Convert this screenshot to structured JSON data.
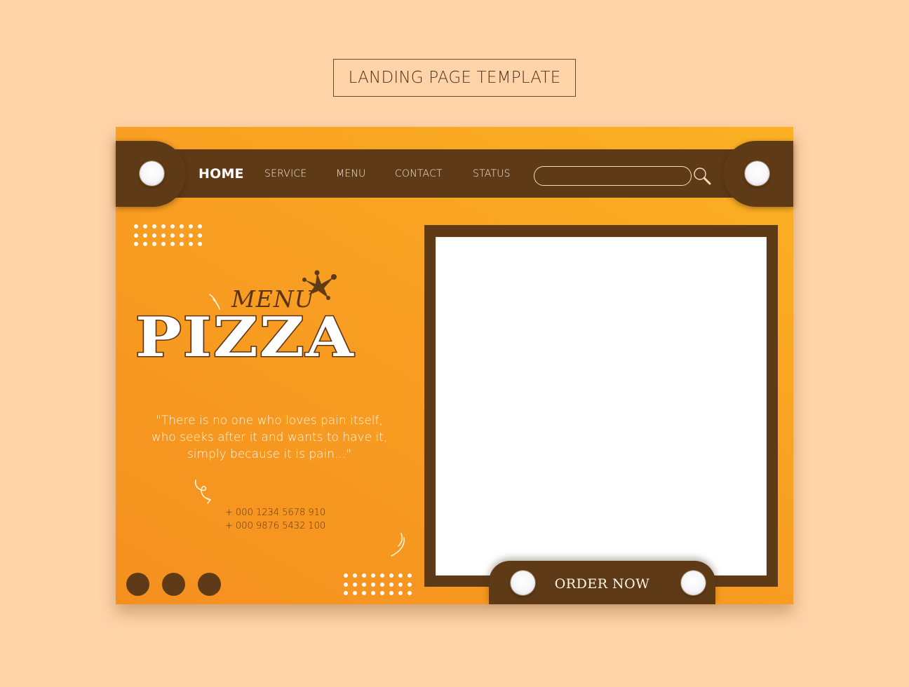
{
  "page": {
    "title": "LANDING PAGE TEMPLATE"
  },
  "colors": {
    "background": "#FFD4A8",
    "card_orange_dark": "#F5901F",
    "card_orange_light": "#FBB123",
    "brown": "#5E3A17",
    "white": "#FFFFFF"
  },
  "nav": {
    "items": [
      {
        "label": "HOME",
        "active": true
      },
      {
        "label": "SERVICE",
        "active": false
      },
      {
        "label": "MENU",
        "active": false
      },
      {
        "label": "CONTACT",
        "active": false
      },
      {
        "label": "STATUS",
        "active": false
      }
    ],
    "search": {
      "value": "",
      "placeholder": "",
      "icon": "search-icon"
    }
  },
  "hero": {
    "script_label": "MENU",
    "headline": "PIZZA",
    "quote": "\"There is no one who loves pain itself, who seeks after it and wants to have it, simply because it is pain...\"",
    "phones": [
      "+ 000 1234 5678 910",
      "+ 000 9876 5432 100"
    ]
  },
  "cta": {
    "label": "ORDER NOW"
  }
}
